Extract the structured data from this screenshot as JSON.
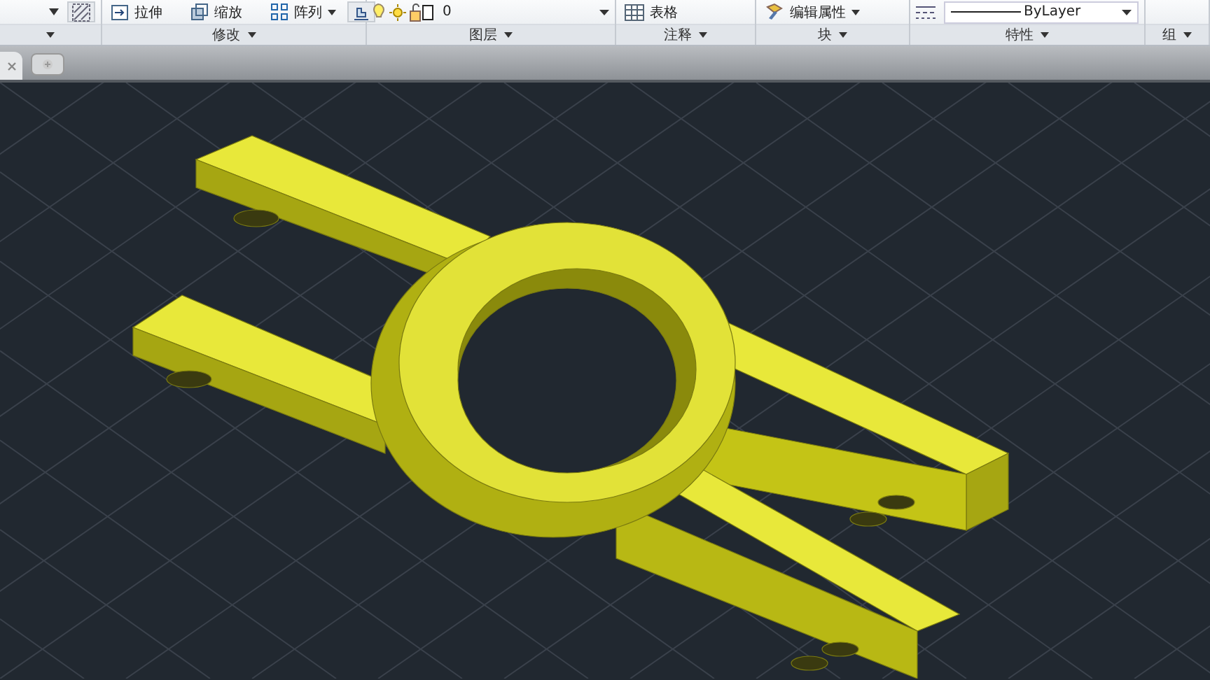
{
  "ribbon": {
    "panels": [
      {
        "tools": [
          {
            "kind": "hatch"
          }
        ]
      },
      {
        "label": "修改",
        "tools": [
          {
            "kind": "stretch",
            "label": "拉伸",
            "dropdown": false
          },
          {
            "kind": "scale",
            "label": "缩放",
            "dropdown": false
          },
          {
            "kind": "array",
            "label": "阵列",
            "dropdown": true
          },
          {
            "kind": "edit"
          }
        ]
      },
      {
        "label": "图层",
        "tools": [
          {
            "kind": "layer",
            "value": "0"
          }
        ]
      },
      {
        "label": "注释",
        "tools": [
          {
            "kind": "table",
            "label": "表格",
            "dropdown": false
          }
        ]
      },
      {
        "label": "块",
        "tools": [
          {
            "kind": "attribute",
            "label": "编辑属性",
            "dropdown": true
          }
        ]
      },
      {
        "label": "特性",
        "tools": [
          {
            "kind": "linetype",
            "value": "ByLayer"
          }
        ]
      },
      {
        "label": "组"
      }
    ]
  }
}
